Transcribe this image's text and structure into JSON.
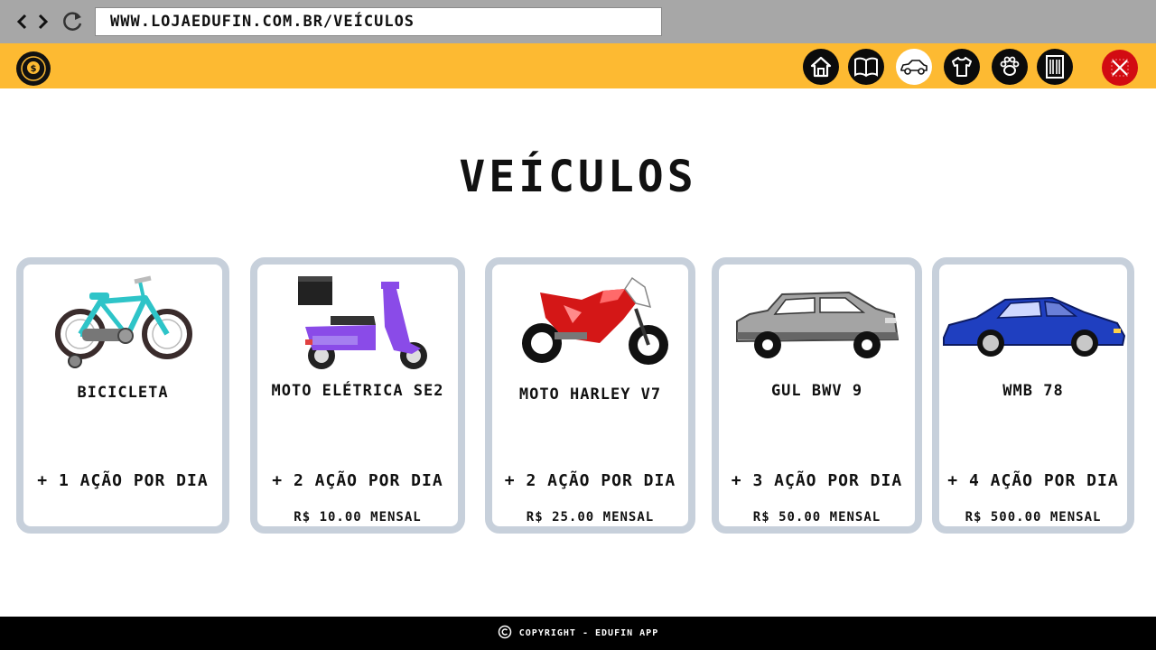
{
  "browser": {
    "url": "www.lojaedufin.com.br/veículos"
  },
  "header": {
    "logo_icon": "coin-logo-icon",
    "nav": [
      {
        "icon": "home-icon"
      },
      {
        "icon": "book-icon"
      },
      {
        "icon": "car-icon",
        "active": true
      },
      {
        "icon": "shirt-icon"
      },
      {
        "icon": "paw-icon"
      },
      {
        "icon": "building-icon"
      }
    ],
    "close_icon": "close-icon"
  },
  "page": {
    "title": "Veículos"
  },
  "products": [
    {
      "name": "Bicicleta",
      "perk": "+ 1 ação por dia",
      "price": "",
      "icon": "bicycle-icon",
      "color": "#2ec4c8"
    },
    {
      "name": "Moto Elétrica SE2",
      "perk": "+ 2 ação por dia",
      "price": "R$ 10.00 mensal",
      "icon": "scooter-icon",
      "color": "#8a4be8"
    },
    {
      "name": "Moto Harley V7",
      "perk": "+ 2 ação por dia",
      "price": "R$ 25.00 mensal",
      "icon": "motorcycle-icon",
      "color": "#d41717"
    },
    {
      "name": "Gul BWV 9",
      "perk": "+ 3 ação por dia",
      "price": "R$ 50.00 mensal",
      "icon": "suv-icon",
      "color": "#9a9a9a"
    },
    {
      "name": "WMB 78",
      "perk": "+ 4 ação por dia",
      "price": "R$ 500.00 mensal",
      "icon": "sports-car-icon",
      "color": "#1f3fc0"
    }
  ],
  "footer": {
    "text": "Copyright - EDUFIN App",
    "icon": "copyright-icon"
  },
  "colors": {
    "browser_bar": "#a7a7a7",
    "header": "#fdba32",
    "card_border": "#c7d0db",
    "close_button": "#d20b12",
    "footer": "#000000"
  }
}
